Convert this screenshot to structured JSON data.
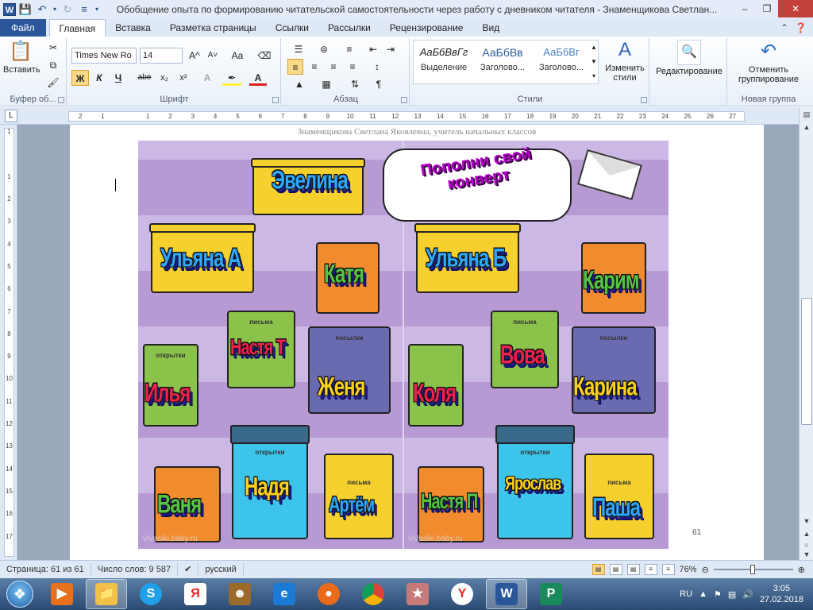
{
  "window": {
    "title": "Обобщение опыта по формированию читательской самостоятельности через работу с дневником читателя - Знаменщикова Светлан...",
    "app_icon": "W"
  },
  "tabs": [
    {
      "label": "Файл"
    },
    {
      "label": "Главная"
    },
    {
      "label": "Вставка"
    },
    {
      "label": "Разметка страницы"
    },
    {
      "label": "Ссылки"
    },
    {
      "label": "Рассылки"
    },
    {
      "label": "Рецензирование"
    },
    {
      "label": "Вид"
    }
  ],
  "ribbon": {
    "clipboard": {
      "label": "Буфер об...",
      "paste": "Вставить"
    },
    "font": {
      "label": "Шрифт",
      "font_name": "Times New Ro",
      "font_size": "14",
      "bold": "Ж",
      "italic": "К",
      "underline": "Ч",
      "strike": "abe",
      "sub": "x₂",
      "sup": "x²",
      "grow": "A^",
      "shrink": "A˅",
      "case": "Aa"
    },
    "paragraph": {
      "label": "Абзац"
    },
    "styles": {
      "label": "Стили",
      "items": [
        {
          "sample": "АаБбВвГг",
          "name": "Выделение"
        },
        {
          "sample": "АаБбВв",
          "name": "Заголово..."
        },
        {
          "sample": "АаБбВг",
          "name": "Заголово..."
        }
      ],
      "change": "Изменить стили"
    },
    "editing": {
      "label": "Редактирование"
    },
    "new_group": {
      "label": "Новая группа",
      "button": "Отменить группирование"
    }
  },
  "ruler": {
    "h_ticks": [
      "2",
      "1",
      "",
      "1",
      "2",
      "3",
      "4",
      "5",
      "6",
      "7",
      "8",
      "9",
      "10",
      "11",
      "12",
      "13",
      "14",
      "15",
      "16",
      "17",
      "18",
      "19",
      "20",
      "21",
      "22",
      "23",
      "24",
      "25",
      "26",
      "27"
    ],
    "v_ticks": [
      "1",
      "",
      "1",
      "2",
      "3",
      "4",
      "5",
      "6",
      "7",
      "8",
      "9",
      "10",
      "11",
      "12",
      "13",
      "14",
      "15",
      "16",
      "17"
    ]
  },
  "document": {
    "header": "Знаменщикова  Светлана  Яковлевна,  учитель  начальных  классов",
    "page_number": "61",
    "picture": {
      "bubble": "Пополни свой конверт",
      "names": [
        "Эвелина",
        "Ульяна А",
        "Катя",
        "Настя Т",
        "Илья",
        "Женя",
        "Ваня",
        "Надя",
        "Артём",
        "Ульяна Б",
        "Карим",
        "Вова",
        "Коля",
        "Карина",
        "Настя П",
        "Ярослав",
        "Паша"
      ],
      "box_labels": [
        "письма",
        "посылки",
        "открытки",
        "письма",
        "письма",
        "посылки",
        "открытки",
        "письма"
      ],
      "watermark": "viVasiki.baby.ru"
    }
  },
  "status": {
    "page": "Страница: 61 из 61",
    "words": "Число слов: 9 587",
    "language": "русский",
    "zoom": "76%",
    "zoom_value": 0.76
  },
  "taskbar": {
    "lang": "RU",
    "time": "3:05",
    "date": "27.02.2018"
  },
  "colors": {
    "accent": "#2b579a",
    "close": "#c4413b"
  }
}
